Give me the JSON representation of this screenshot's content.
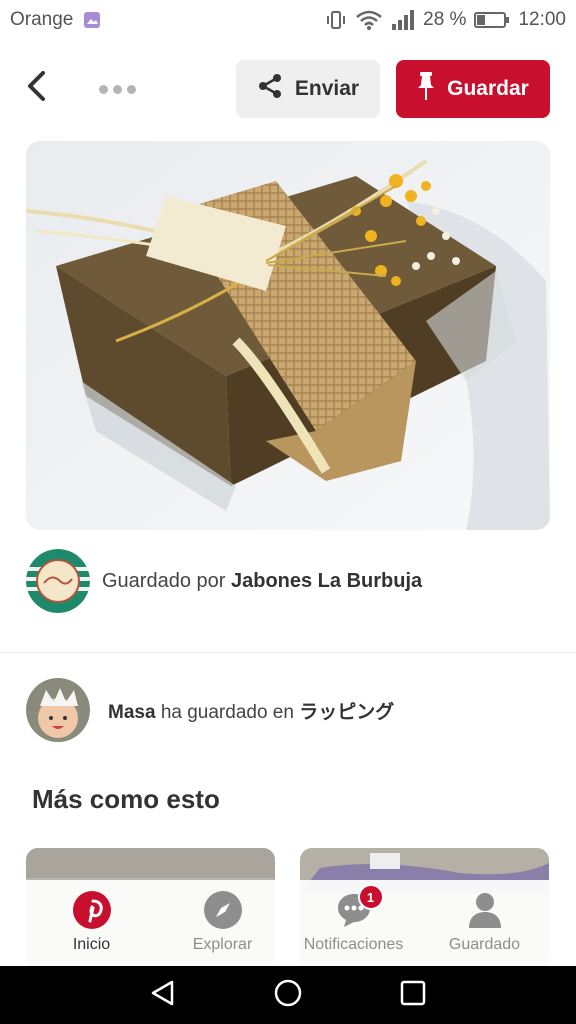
{
  "status_bar": {
    "carrier": "Orange",
    "battery_percent": "28 %",
    "time": "12:00",
    "icons": [
      "image-notification-icon",
      "vibrate-icon",
      "wifi-icon",
      "signal-icon",
      "battery-icon"
    ]
  },
  "toolbar": {
    "back_icon": "chevron-left-icon",
    "more_icon": "more-dots-icon",
    "send_label": "Enviar",
    "send_icon": "share-icon",
    "save_label": "Guardar",
    "save_icon": "pin-icon"
  },
  "pin": {
    "image_description_icon": "soap-gift-photo"
  },
  "saved_by": {
    "prefix": "Guardado por",
    "board": "Jabones La Burbuja"
  },
  "activity": {
    "user": "Masa",
    "action": "ha guardado en",
    "board": "ラッピング"
  },
  "more_like_this": {
    "title": "Más como esto"
  },
  "tabbar": {
    "items": [
      {
        "label": "Inicio",
        "icon": "pinterest-logo-icon",
        "active": true
      },
      {
        "label": "Explorar",
        "icon": "compass-icon",
        "active": false
      },
      {
        "label": "Notificaciones",
        "icon": "chat-bubble-icon",
        "badge": "1",
        "active": false
      },
      {
        "label": "Guardado",
        "icon": "person-icon",
        "active": false
      }
    ]
  },
  "colors": {
    "brand_red": "#c8102e",
    "tab_gray": "#8e8e8e"
  }
}
